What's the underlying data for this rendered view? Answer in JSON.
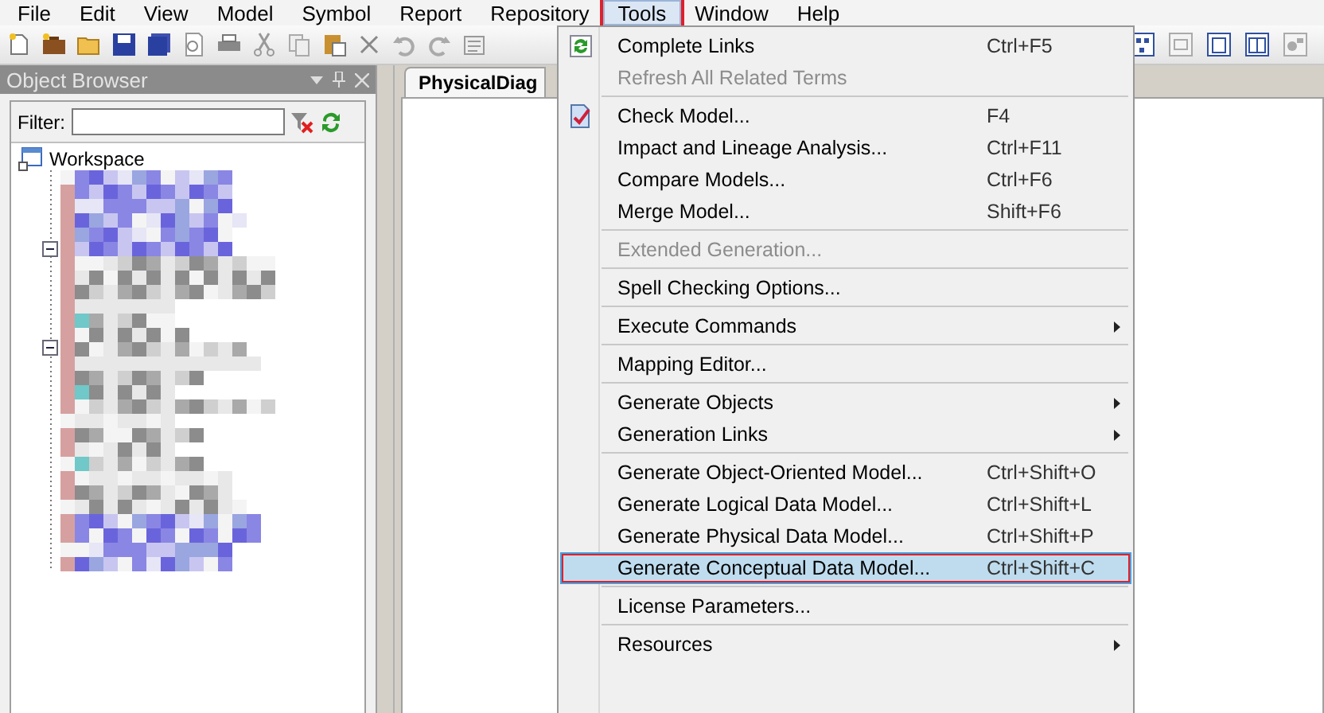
{
  "menubar": [
    {
      "label": "File",
      "selected": false,
      "annotated": false
    },
    {
      "label": "Edit",
      "selected": false,
      "annotated": false
    },
    {
      "label": "View",
      "selected": false,
      "annotated": false
    },
    {
      "label": "Model",
      "selected": false,
      "annotated": false
    },
    {
      "label": "Symbol",
      "selected": false,
      "annotated": false
    },
    {
      "label": "Report",
      "selected": false,
      "annotated": false
    },
    {
      "label": "Repository",
      "selected": false,
      "annotated": false
    },
    {
      "label": "Tools",
      "selected": true,
      "annotated": true
    },
    {
      "label": "Window",
      "selected": false,
      "annotated": false
    },
    {
      "label": "Help",
      "selected": false,
      "annotated": false
    }
  ],
  "object_browser": {
    "title": "Object Browser",
    "filter_label": "Filter:",
    "tree_root": "Workspace"
  },
  "document_tab": {
    "label": "PhysicalDiag"
  },
  "tools_menu": [
    {
      "kind": "iconitem",
      "label": "Complete Links",
      "shortcut": "Ctrl+F5",
      "disabled": false,
      "submenu": false,
      "selected": false,
      "annotated": false
    },
    {
      "kind": "item",
      "label": "Refresh All Related Terms",
      "disabled": true,
      "submenu": false,
      "selected": false,
      "annotated": false
    },
    {
      "kind": "separator"
    },
    {
      "kind": "iconitem",
      "label": "Check Model...",
      "shortcut": "F4",
      "disabled": false,
      "submenu": false,
      "selected": false,
      "annotated": false
    },
    {
      "kind": "item",
      "label": "Impact and Lineage Analysis...",
      "shortcut": "Ctrl+F11",
      "disabled": false,
      "submenu": false,
      "selected": false,
      "annotated": false
    },
    {
      "kind": "item",
      "label": "Compare Models...",
      "shortcut": "Ctrl+F6",
      "disabled": false,
      "submenu": false,
      "selected": false,
      "annotated": false
    },
    {
      "kind": "item",
      "label": "Merge Model...",
      "shortcut": "Shift+F6",
      "disabled": false,
      "submenu": false,
      "selected": false,
      "annotated": false
    },
    {
      "kind": "separator"
    },
    {
      "kind": "item",
      "label": "Extended Generation...",
      "disabled": true,
      "submenu": false,
      "selected": false,
      "annotated": false
    },
    {
      "kind": "separator"
    },
    {
      "kind": "item",
      "label": "Spell Checking Options...",
      "disabled": false,
      "submenu": false,
      "selected": false,
      "annotated": false
    },
    {
      "kind": "separator"
    },
    {
      "kind": "item",
      "label": "Execute Commands",
      "disabled": false,
      "submenu": true,
      "selected": false,
      "annotated": false
    },
    {
      "kind": "separator"
    },
    {
      "kind": "item",
      "label": "Mapping Editor...",
      "disabled": false,
      "submenu": false,
      "selected": false,
      "annotated": false
    },
    {
      "kind": "separator"
    },
    {
      "kind": "item",
      "label": "Generate Objects",
      "disabled": false,
      "submenu": true,
      "selected": false,
      "annotated": false
    },
    {
      "kind": "item",
      "label": "Generation Links",
      "disabled": false,
      "submenu": true,
      "selected": false,
      "annotated": false
    },
    {
      "kind": "separator"
    },
    {
      "kind": "item",
      "label": "Generate Object-Oriented Model...",
      "shortcut": "Ctrl+Shift+O",
      "disabled": false,
      "submenu": false,
      "selected": false,
      "annotated": false
    },
    {
      "kind": "item",
      "label": "Generate Logical Data Model...",
      "shortcut": "Ctrl+Shift+L",
      "disabled": false,
      "submenu": false,
      "selected": false,
      "annotated": false
    },
    {
      "kind": "item",
      "label": "Generate Physical Data Model...",
      "shortcut": "Ctrl+Shift+P",
      "disabled": false,
      "submenu": false,
      "selected": false,
      "annotated": false
    },
    {
      "kind": "item",
      "label": "Generate Conceptual Data Model...",
      "shortcut": "Ctrl+Shift+C",
      "disabled": false,
      "submenu": false,
      "selected": true,
      "annotated": true
    },
    {
      "kind": "separator"
    },
    {
      "kind": "item",
      "label": "License Parameters...",
      "disabled": false,
      "submenu": false,
      "selected": false,
      "annotated": false
    },
    {
      "kind": "separator"
    },
    {
      "kind": "item",
      "label": "Resources",
      "disabled": false,
      "submenu": true,
      "selected": false,
      "annotated": false
    }
  ]
}
